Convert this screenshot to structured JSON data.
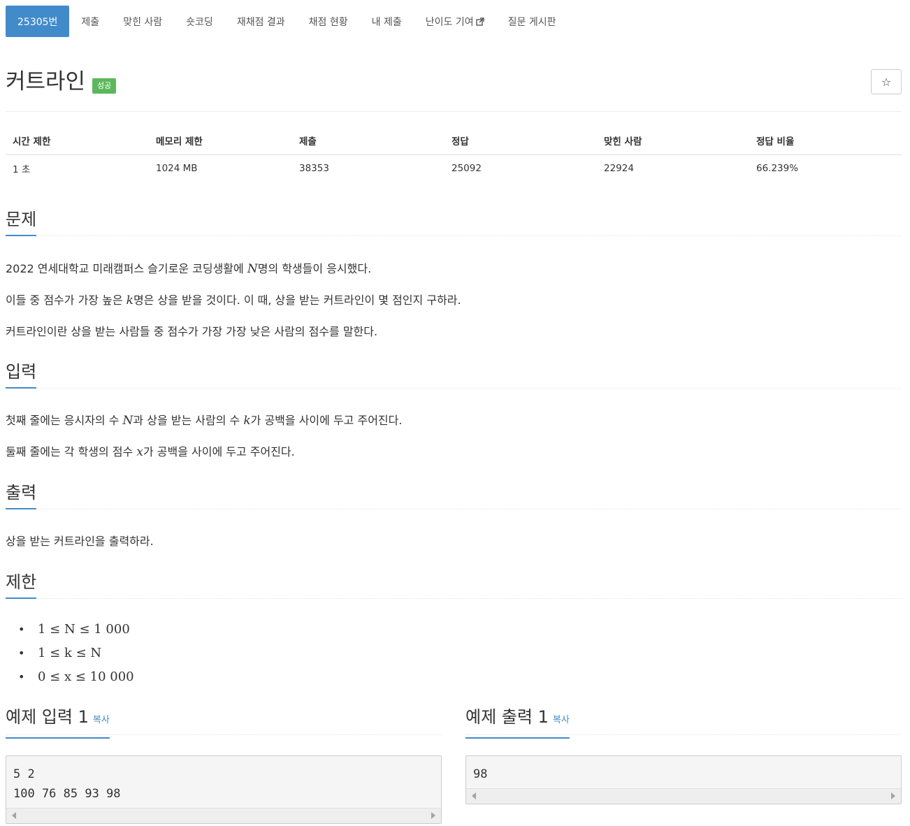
{
  "nav": {
    "tabs": [
      {
        "label": "25305번",
        "active": true
      },
      {
        "label": "제출"
      },
      {
        "label": "맞힌 사람"
      },
      {
        "label": "숏코딩"
      },
      {
        "label": "재채점 결과"
      },
      {
        "label": "채점 현황"
      },
      {
        "label": "내 제출"
      },
      {
        "label": "난이도 기여",
        "icon": "external-link-icon"
      },
      {
        "label": "질문 게시판"
      }
    ]
  },
  "problem": {
    "title": "커트라인",
    "badge": "성공",
    "star_icon": "☆"
  },
  "info": {
    "headers": [
      "시간 제한",
      "메모리 제한",
      "제출",
      "정답",
      "맞힌 사람",
      "정답 비율"
    ],
    "values": [
      "1 초",
      "1024 MB",
      "38353",
      "25092",
      "22924",
      "66.239%"
    ]
  },
  "sections": {
    "problem_heading": "문제",
    "p1a": "2022 연세대학교 미래캠퍼스 슬기로운 코딩생활에 ",
    "p1var": "N",
    "p1b": "명의 학생들이 응시했다.",
    "p2a": "이들 중 점수가 가장 높은 ",
    "p2var": "k",
    "p2b": "명은 상을 받을 것이다. 이 때, 상을 받는 커트라인이 몇 점인지 구하라.",
    "p3": "커트라인이란 상을 받는 사람들 중 점수가 가장 가장 낮은 사람의 점수를 말한다.",
    "input_heading": "입력",
    "i1a": "첫째 줄에는 응시자의 수 ",
    "i1var1": "N",
    "i1b": "과 상을 받는 사람의 수 ",
    "i1var2": "k",
    "i1c": "가 공백을 사이에 두고 주어진다.",
    "i2a": "둘째 줄에는 각 학생의 점수 ",
    "i2var": "x",
    "i2b": "가 공백을 사이에 두고 주어진다.",
    "output_heading": "출력",
    "o1": "상을 받는 커트라인을 출력하라.",
    "limit_heading": "제한",
    "limits": [
      "1 ≤ N ≤ 1 000",
      "1 ≤ k ≤ N",
      "0 ≤ x ≤ 10 000"
    ]
  },
  "examples": {
    "input_title": "예제 입력 1",
    "output_title": "예제 출력 1",
    "copy_label": "복사",
    "input_lines": [
      "5 2",
      "100 76 85 93 98"
    ],
    "output_lines": [
      "98"
    ]
  }
}
